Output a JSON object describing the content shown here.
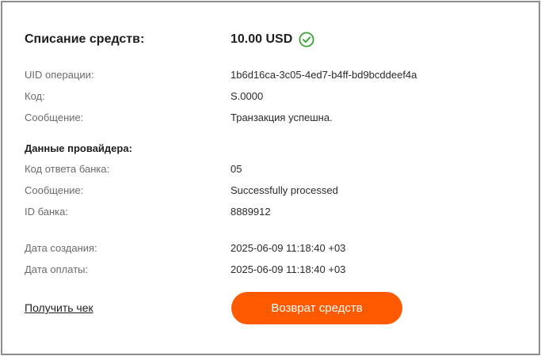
{
  "header": {
    "title": "Списание средств:",
    "amount": "10.00 USD",
    "status_icon": "check-circle-icon",
    "status_color": "#3aa335"
  },
  "operation": {
    "uid_label": "UID операции:",
    "uid_value": "1b6d16ca-3c05-4ed7-b4ff-bd9bcddeef4a",
    "code_label": "Код:",
    "code_value": "S.0000",
    "message_label": "Сообщение:",
    "message_value": "Транзакция успешна."
  },
  "provider": {
    "heading": "Данные провайдера:",
    "bank_code_label": "Код ответа банка:",
    "bank_code_value": "05",
    "message_label": "Сообщение:",
    "message_value": "Successfully processed",
    "bank_id_label": "ID банка:",
    "bank_id_value": "8889912"
  },
  "dates": {
    "created_label": "Дата создания:",
    "created_value": "2025-06-09 11:18:40 +03",
    "paid_label": "Дата оплаты:",
    "paid_value": "2025-06-09 11:18:40 +03"
  },
  "actions": {
    "receipt_link": "Получить чек",
    "refund_button": "Возврат средств",
    "accent_color": "#ff5a00"
  }
}
